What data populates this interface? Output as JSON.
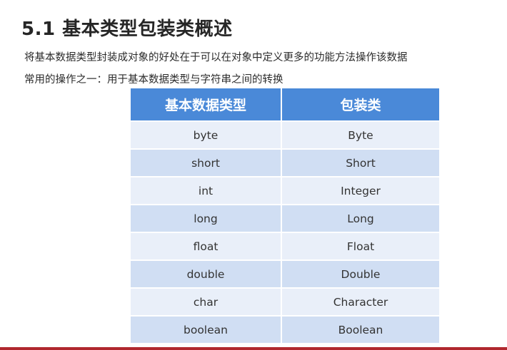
{
  "slide": {
    "title": "5.1 基本类型包装类概述",
    "description_lines": [
      "将基本数据类型封装成对象的好处在于可以在对象中定义更多的功能方法操作该数据",
      "常用的操作之一：用于基本数据类型与字符串之间的转换"
    ]
  },
  "table": {
    "headers": [
      "基本数据类型",
      "包装类"
    ],
    "rows": [
      [
        "byte",
        "Byte"
      ],
      [
        "short",
        "Short"
      ],
      [
        "int",
        "Integer"
      ],
      [
        "long",
        "Long"
      ],
      [
        "float",
        "Float"
      ],
      [
        "double",
        "Double"
      ],
      [
        "char",
        "Character"
      ],
      [
        "boolean",
        "Boolean"
      ]
    ]
  },
  "colors": {
    "header_bg": "#4a89d8",
    "row_light": "#e9eff9",
    "row_dark": "#d0def3",
    "bottom_bar": "#b0282e"
  }
}
